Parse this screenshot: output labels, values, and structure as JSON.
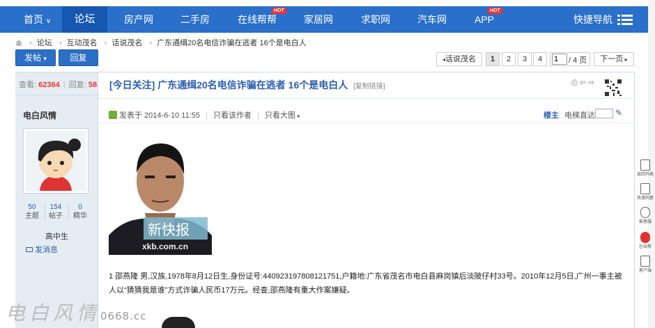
{
  "nav": {
    "items": [
      {
        "label": "首页",
        "active": false
      },
      {
        "label": "论坛",
        "active": true
      },
      {
        "label": "房产网"
      },
      {
        "label": "二手房"
      },
      {
        "label": "在线帮帮",
        "hot": "HOT"
      },
      {
        "label": "家居网"
      },
      {
        "label": "求职网"
      },
      {
        "label": "汽车网"
      },
      {
        "label": "APP",
        "hot": "HOT"
      }
    ],
    "home_caret": "∨",
    "quick_nav": "快捷导航",
    "accent": "#2a6fc9"
  },
  "breadcrumb": [
    "论坛",
    "互动茂名",
    "话说茂名",
    "广东通缉20名电信诈骗在逃者 16个是电白人"
  ],
  "actions": {
    "post": "发帖",
    "post_caret": "▾",
    "reply": "回复"
  },
  "pager": {
    "back": "话说茂名",
    "pages": [
      "1",
      "2",
      "3",
      "4"
    ],
    "current": "1",
    "input_value": "1",
    "total": "/ 4 页",
    "next": "下一页"
  },
  "thread": {
    "views_label": "查看:",
    "views": "62364",
    "replies_label": "回复:",
    "replies": "58",
    "title": "[今日关注] 广东通缉20名电信诈骗在逃者 16个是电白人",
    "copy_link": "[复制链接]"
  },
  "author": {
    "name": "电白风情",
    "stats": [
      {
        "value": "50",
        "label": "主题"
      },
      {
        "value": "154",
        "label": "帖子"
      },
      {
        "value": "0",
        "label": "精华"
      }
    ],
    "level": "高中生",
    "send_msg": "发消息"
  },
  "post": {
    "posted": "发表于 2014-6-10 11:55",
    "only_author": "只看该作者",
    "only_big": "只看大图",
    "floor": "楼主",
    "elevator": "电梯直达",
    "photo_logo": "新快报",
    "photo_url": "xkb.com.cn",
    "body": "1 邵燕隆 男,汉族,1978年8月12日生,身份证号:440923197808121751,户籍地:广东省茂名市电白县麻岗镇后淡陂仔村33号。2010年12月5日,广州一事主被人以“猜猜我是谁”方式诈骗人民币17万元。经查,邵燕隆有重大作案嫌疑。"
  },
  "rail": [
    {
      "label": "返回列表",
      "icon": "list-icon"
    },
    {
      "label": "快速回复",
      "icon": "reply-icon"
    },
    {
      "label": "报客服",
      "icon": "headset-icon"
    },
    {
      "label": "在线帮",
      "icon": "help-icon"
    },
    {
      "label": "客户端",
      "icon": "app-icon"
    }
  ],
  "watermark": {
    "text": "电白风情",
    "domain": "0668.cc"
  }
}
